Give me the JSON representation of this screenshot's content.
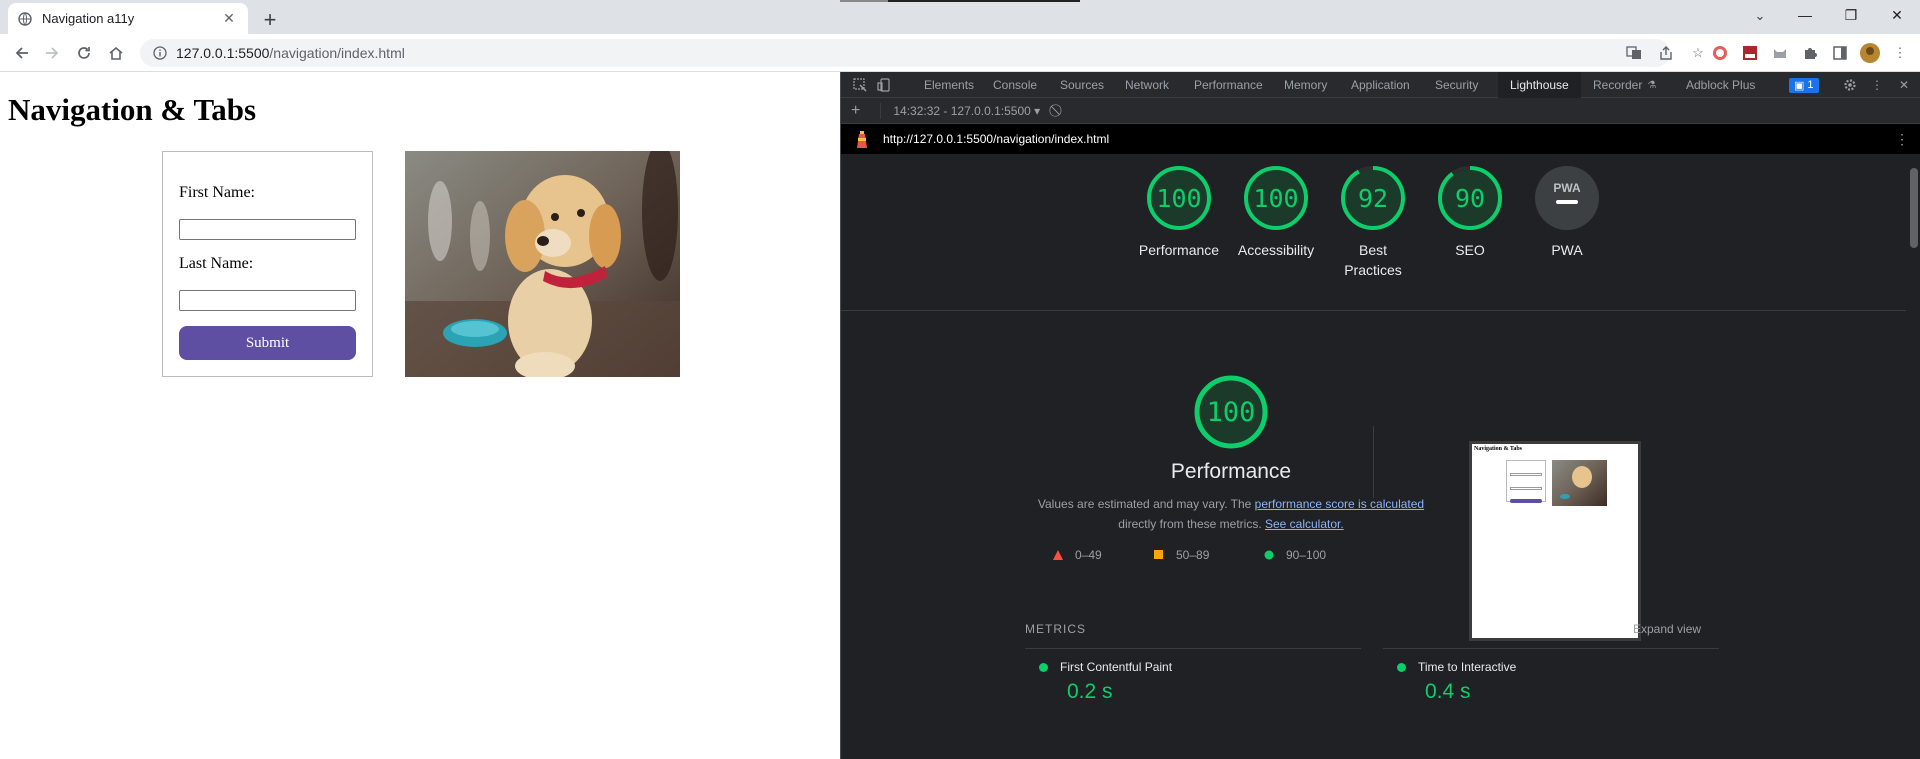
{
  "browser": {
    "tab_title": "Navigation a11y",
    "url_host": "127.0.0.1:5500",
    "url_path": "/navigation/index.html"
  },
  "page": {
    "heading": "Navigation & Tabs",
    "first_name_label": "First Name:",
    "first_name_value": "",
    "last_name_label": "Last Name:",
    "last_name_value": "",
    "submit_label": "Submit"
  },
  "devtools": {
    "tabs": [
      "Elements",
      "Console",
      "Sources",
      "Network",
      "Performance",
      "Memory",
      "Application",
      "Security",
      "Lighthouse",
      "Recorder",
      "Adblock Plus"
    ],
    "active_tab": "Lighthouse",
    "issues_count": "1",
    "report_selector": "14:32:32 - 127.0.0.1:5500",
    "report_url": "http://127.0.0.1:5500/navigation/index.html"
  },
  "lighthouse": {
    "scores": [
      {
        "label": "Performance",
        "value": "100",
        "fraction": 1.0
      },
      {
        "label": "Accessibility",
        "value": "100",
        "fraction": 1.0
      },
      {
        "label": "Best Practices",
        "value": "92",
        "fraction": 0.92
      },
      {
        "label": "SEO",
        "value": "90",
        "fraction": 0.9
      },
      {
        "label": "PWA",
        "value": "PWA",
        "fraction": 0
      }
    ],
    "main_score": "100",
    "main_title": "Performance",
    "desc_prefix": "Values are estimated and may vary. The ",
    "desc_link1": "performance score is calculated",
    "desc_middle": " directly from these metrics. ",
    "desc_link2": "See calculator.",
    "legend": [
      {
        "range": "0–49",
        "color": "#ff4e42"
      },
      {
        "range": "50–89",
        "color": "#ffa400"
      },
      {
        "range": "90–100",
        "color": "#0cce6b"
      }
    ],
    "metrics_heading": "METRICS",
    "expand_label": "Expand view",
    "metrics": [
      {
        "name": "First Contentful Paint",
        "value": "0.2 s"
      },
      {
        "name": "Time to Interactive",
        "value": "0.4 s"
      }
    ],
    "colors": {
      "pass": "#0cce6b",
      "gauge_bg": "#1f3b2b"
    }
  }
}
